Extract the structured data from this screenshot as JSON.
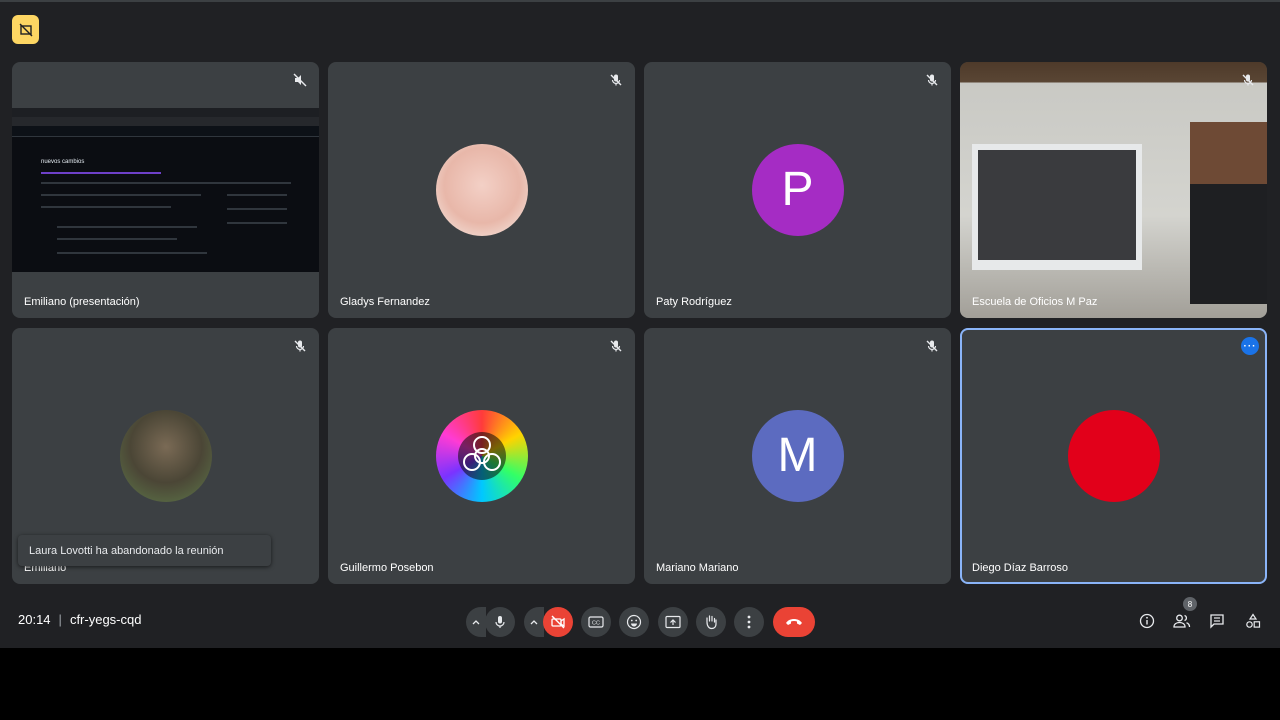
{
  "meeting": {
    "time": "20:14",
    "separator": "|",
    "code": "cfr-yegs-cqd"
  },
  "tiles": [
    {
      "name": "Emiliano (presentación)",
      "type": "screen"
    },
    {
      "name": "Gladys Fernandez",
      "type": "photo-avatar"
    },
    {
      "name": "Paty Rodríguez",
      "type": "letter-avatar",
      "letter": "P",
      "color": "#a52cc4"
    },
    {
      "name": "Escuela de Oficios M Paz",
      "type": "camera"
    },
    {
      "name": "Emiliano",
      "type": "photo-avatar"
    },
    {
      "name": "Guillermo Posebon",
      "type": "photo-avatar"
    },
    {
      "name": "Mariano Mariano",
      "type": "letter-avatar",
      "letter": "M",
      "color": "#5c6bc0"
    },
    {
      "name": "Diego Díaz Barroso",
      "type": "solid-avatar",
      "color": "#e2001a",
      "active": true
    }
  ],
  "shared_screen": {
    "title": "nuevos cambios"
  },
  "toast": "Laura Lovotti ha abandonado la reunión",
  "participants_count": "8",
  "controls": {
    "mic": "mic-icon",
    "camera": "camera-off-icon",
    "captions": "CC",
    "emoji": "emoji-icon",
    "present": "present-icon",
    "hand": "raise-hand-icon",
    "more": "more-vert-icon",
    "end": "end-call-icon"
  },
  "colors": {
    "background": "#202124",
    "tile": "#3c4043",
    "end_call": "#ea4335",
    "active_border": "#8ab4f8",
    "badge_yellow": "#fdd663"
  }
}
